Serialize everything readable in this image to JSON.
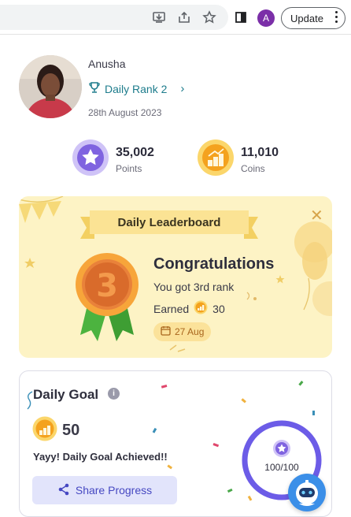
{
  "browser": {
    "update_label": "Update",
    "profile_initial": "A",
    "icons": [
      "install-icon",
      "share-icon",
      "star-icon",
      "sidebar-icon",
      "kebab-menu-icon"
    ]
  },
  "profile": {
    "name": "Anusha",
    "rank_label": "Daily Rank 2",
    "date": "28th August 2023"
  },
  "stats": {
    "points_value": "35,002",
    "points_label": "Points",
    "coins_value": "11,010",
    "coins_label": "Coins"
  },
  "leaderboard": {
    "title": "Daily Leaderboard",
    "medal_rank": "3",
    "heading": "Congratulations",
    "message": "You got 3rd rank",
    "earned_label": "Earned",
    "earned_value": "30",
    "date": "27 Aug"
  },
  "daily_goal": {
    "title": "Daily Goal",
    "info_glyph": "i",
    "coins": "50",
    "message": "Yayy! Daily Goal Achieved!!",
    "share_label": "Share Progress",
    "progress_text": "100/100",
    "progress_fraction": 1.0
  },
  "colors": {
    "accent_purple": "#6c5ce7",
    "coin_orange": "#f5a623",
    "teal_link": "#1d7c8c",
    "lb_background": "#fdf3c5"
  }
}
